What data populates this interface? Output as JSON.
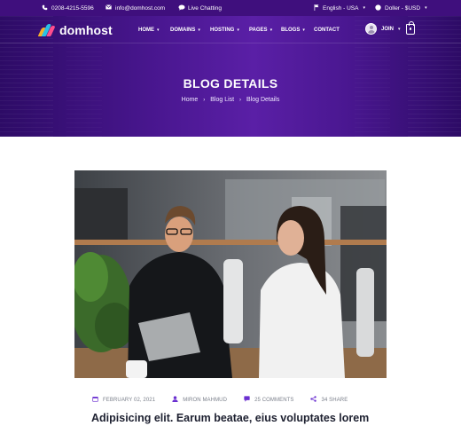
{
  "topbar": {
    "phone": "0208-4215-5596",
    "email": "info@domhost.com",
    "chat": "Live Chatting",
    "language": "English - USA",
    "currency": "Doller - $USD"
  },
  "brand": {
    "name": "domhost"
  },
  "nav": {
    "items": [
      {
        "label": "HOME",
        "dropdown": true
      },
      {
        "label": "DOMAINS",
        "dropdown": true
      },
      {
        "label": "HOSTING",
        "dropdown": true
      },
      {
        "label": "PAGES",
        "dropdown": true
      },
      {
        "label": "BLOGS",
        "dropdown": true
      },
      {
        "label": "CONTACT",
        "dropdown": false
      }
    ],
    "join": "JOIN"
  },
  "hero": {
    "title": "BLOG DETAILS",
    "breadcrumb": [
      "Home",
      "Blog List",
      "Blog Details"
    ]
  },
  "post": {
    "date": "FEBRUARY 02, 2021",
    "author": "MIRON MAHMUD",
    "comments": "25 COMMENTS",
    "shares": "34 SHARE",
    "title": "Adipisicing elit. Earum beatae, eius voluptates lorem",
    "image_alt": "blog-photo"
  },
  "colors": {
    "primary": "#3f0f7d",
    "accent": "#6a2fd0",
    "title": "#1d2030"
  },
  "icons": {
    "phone": "phone-icon",
    "email": "envelope-icon",
    "chat": "chat-bubble-icon",
    "language": "flag-icon",
    "currency": "globe-icon",
    "cart": "shopping-bag-icon",
    "date": "calendar-icon",
    "author": "user-icon",
    "comments": "comment-icon",
    "share": "share-icon"
  }
}
